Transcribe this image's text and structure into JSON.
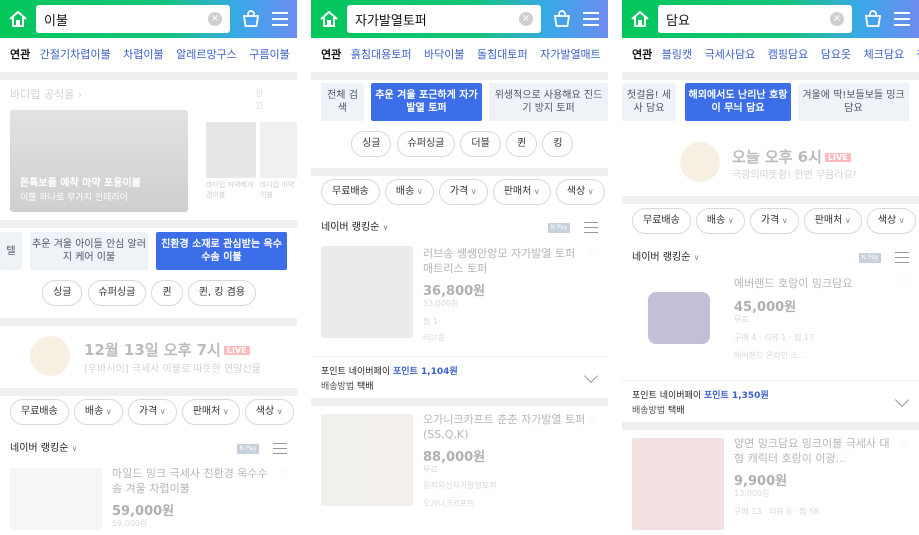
{
  "panels": [
    {
      "query": "이불",
      "related_label": "연관",
      "related": [
        "간절기차렵이불",
        "차렵이불",
        "알레르망구스",
        "구름이불"
      ],
      "section_title": "바디럽 공식몰",
      "section_more": "광고",
      "banner": {
        "title": "폰톡보풀 예착 마약 포용이불",
        "subtitle": "이불 하나로 무가지 인테리어"
      },
      "thumb_captions": [
        "바디럽 마약베개 겸이불",
        "바디럽 마약 포용이불"
      ],
      "boxes": [
        {
          "label": "텔",
          "active": false
        },
        {
          "label": "추운 겨울 아이들 안심 알러지 케어 이불",
          "active": false
        },
        {
          "label": "친환경 소재로 관심받는 옥수수솜 이불",
          "active": true
        }
      ],
      "chips": [
        "싱글",
        "슈퍼싱글",
        "퀸",
        "퀸, 킹 겸용"
      ],
      "live": {
        "time": "12월 13일 오후 7시",
        "badge": "LIVE",
        "sub": "[우바시이] 극세사 이불로 따뜻한 연말선물"
      },
      "filters": [
        "무료배송",
        "배송",
        "가격",
        "판매처",
        "색상"
      ],
      "rank_label": "네이버 랭킹순",
      "npay": "N Pay",
      "products": [
        {
          "title": "마일드 밍크 극세사 친환경 옥수수솜 겨울 차렵이불",
          "price": "59,000원",
          "sub": "59,000원"
        }
      ]
    },
    {
      "query": "자가발열토퍼",
      "related_label": "연관",
      "related": [
        "흙침대용토퍼",
        "바닥이불",
        "돌침대토퍼",
        "자가발열매트"
      ],
      "boxes": [
        {
          "label": "전체 검색",
          "active": false
        },
        {
          "label": "추운 겨울 포근하게 자가발열 토퍼",
          "active": true
        },
        {
          "label": "위생적으로 사용해요 진드기 방지 토퍼",
          "active": false
        }
      ],
      "chips": [
        "싱글",
        "슈퍼싱글",
        "더블",
        "퀸",
        "킹"
      ],
      "filters": [
        "무료배송",
        "배송",
        "가격",
        "판매처",
        "색상"
      ],
      "rank_label": "네이버 랭킹순",
      "npay": "N Pay",
      "products": [
        {
          "title": "러브송 쌩쌩안양모 자가발열 토퍼 매트리스 토퍼",
          "price": "36,800원",
          "sub": "53,000원",
          "extra": "찜 1",
          "store": "러브송"
        },
        {
          "title": "오가니크카프트 춘춘 자가발열 토퍼 (SS,Q,K)",
          "price": "88,000원",
          "sub": "무료",
          "extra": "원적외선자가발열토퍼",
          "store": "오가니크카프트"
        }
      ],
      "point": {
        "label": "포인트",
        "pay": "네이버페이",
        "amount": "포인트 1,104원",
        "delivery_label": "배송방법",
        "delivery": "택배"
      }
    },
    {
      "query": "담요",
      "related_label": "연관",
      "related": [
        "블링캣",
        "극세사담요",
        "캠핑담요",
        "담요옷",
        "체크담요",
        "첨"
      ],
      "boxes": [
        {
          "label": "첫걸음! 세사 담요",
          "active": false
        },
        {
          "label": "해외에서도 난리난 호랑이 무늬 담요",
          "active": true
        },
        {
          "label": "겨울에 딱!보들보들 밍크 담요",
          "active": false
        }
      ],
      "live": {
        "time": "오늘 오후 6시",
        "badge": "LIVE",
        "sub": "극광의따뜻함! 한번 무음라요!"
      },
      "filters": [
        "무료배송",
        "배송",
        "가격",
        "판매처",
        "색상"
      ],
      "rank_label": "네이버 랭킹순",
      "npay": "N Pay",
      "products": [
        {
          "title": "에버랜드 호랑이 밍크담요",
          "price": "45,000원",
          "sub": "무료",
          "extra": "구매 4 · 리뷰 1 · 찜 17",
          "store": "에버랜드 온라인 스..."
        },
        {
          "title": "양면 밍크담요 밍크이불 극세사 대형 캐릭터 호랑이 이광...",
          "price": "9,900원",
          "sub": "13,000원",
          "extra": "구매 13 · 리뷰 6 · 찜 58"
        }
      ],
      "point": {
        "label": "포인트",
        "pay": "네이버페이",
        "amount": "포인트 1,350원",
        "delivery_label": "배송방법",
        "delivery": "택배"
      }
    }
  ]
}
